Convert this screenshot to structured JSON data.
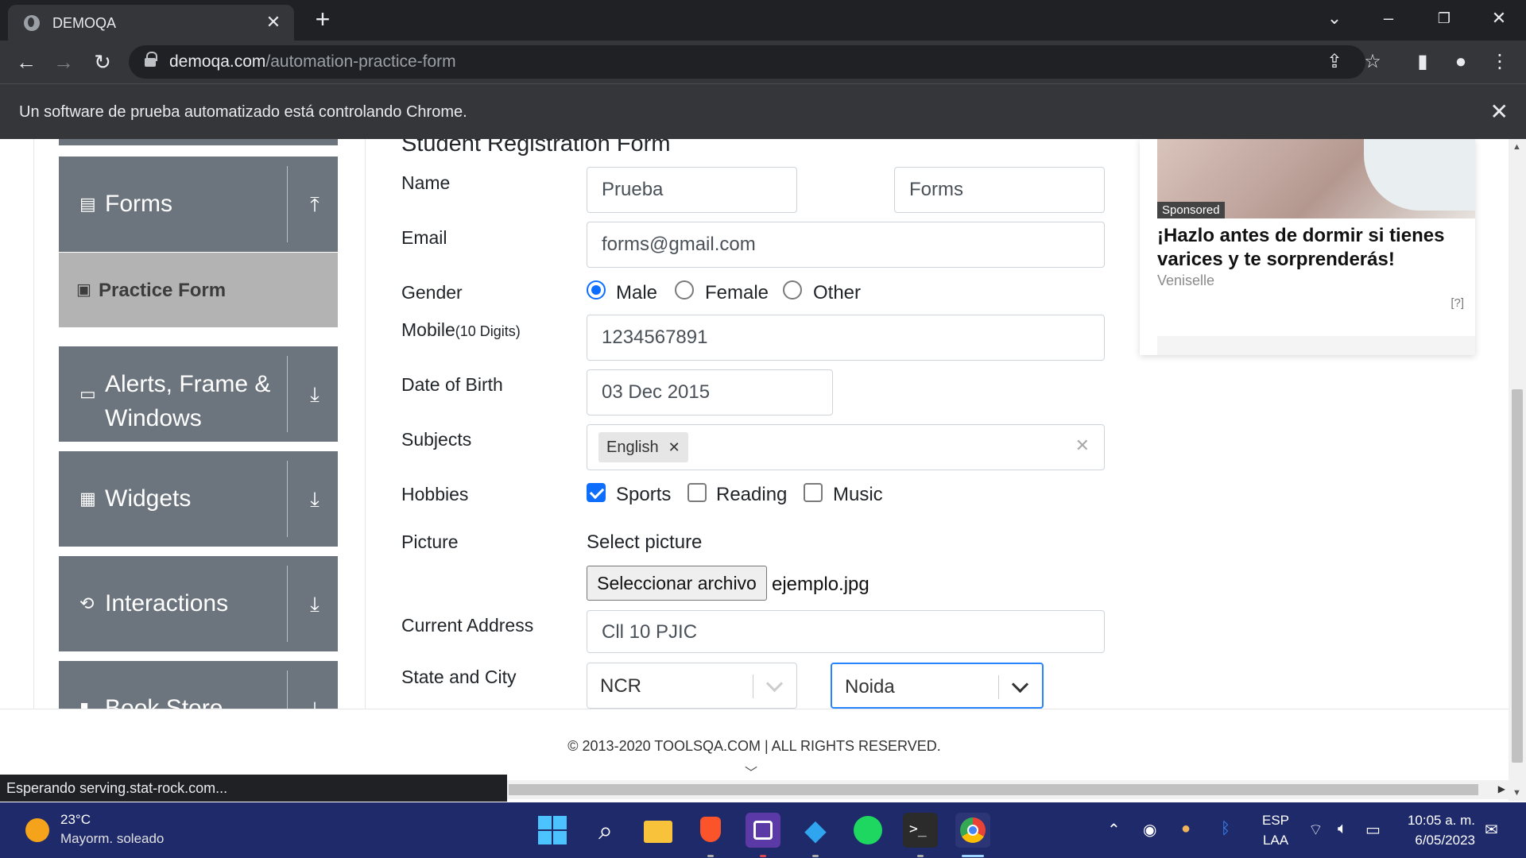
{
  "browser": {
    "tab_title": "DEMOQA",
    "url_host": "demoqa.com",
    "url_path": "/automation-practice-form",
    "infobar_message": "Un software de prueba automatizado está controlando Chrome."
  },
  "sidebar": {
    "items": [
      {
        "label": "Forms",
        "icon": "document-icon",
        "arrow": "collapse-arrow"
      },
      {
        "label": "Practice Form",
        "icon": "clipboard-icon"
      },
      {
        "label": "Alerts, Frame & Windows",
        "icon": "window-icon",
        "arrow": "expand-arrow"
      },
      {
        "label": "Widgets",
        "icon": "widgets-icon",
        "arrow": "expand-arrow"
      },
      {
        "label": "Interactions",
        "icon": "interactions-icon",
        "arrow": "expand-arrow"
      },
      {
        "label": "Book Store",
        "icon": "bar-chart-icon",
        "arrow": "expand-arrow"
      }
    ]
  },
  "form": {
    "heading": "Student Registration Form",
    "name_label": "Name",
    "first_name": "Prueba",
    "last_name": "Forms",
    "email_label": "Email",
    "email": "forms@gmail.com",
    "gender_label": "Gender",
    "gender_options": [
      "Male",
      "Female",
      "Other"
    ],
    "gender_selected": "Male",
    "mobile_label": "Mobile",
    "mobile_hint": "(10 Digits)",
    "mobile": "1234567891",
    "dob_label": "Date of Birth",
    "dob": "03 Dec 2015",
    "subjects_label": "Subjects",
    "subjects": [
      "English"
    ],
    "hobbies_label": "Hobbies",
    "hobbies": [
      {
        "label": "Sports",
        "checked": true
      },
      {
        "label": "Reading",
        "checked": false
      },
      {
        "label": "Music",
        "checked": false
      }
    ],
    "picture_label": "Picture",
    "picture_hint": "Select picture",
    "file_button": "Seleccionar archivo",
    "file_name": "ejemplo.jpg",
    "address_label": "Current Address",
    "address": "Cll 10 PJIC",
    "state_city_label": "State and City",
    "state": "NCR",
    "city": "Noida"
  },
  "ad": {
    "sponsored": "Sponsored",
    "headline": "¡Hazlo antes de dormir si tienes varices y te sorprenderás!",
    "brand": "Veniselle",
    "info": "[?]"
  },
  "footer": {
    "copyright": "© 2013-2020 TOOLSQA.COM | ALL RIGHTS RESERVED."
  },
  "status_bar": "Esperando serving.stat-rock.com...",
  "taskbar": {
    "weather_temp": "23°C",
    "weather_desc": "Mayorm. soleado",
    "lang_top": "ESP",
    "lang_bottom": "LAA",
    "time": "10:05 a. m.",
    "date": "6/05/2023"
  },
  "colors": {
    "primary": "#0d6efd",
    "sidebar_gray": "#6c757d",
    "taskbar": "#1f2a6b"
  }
}
